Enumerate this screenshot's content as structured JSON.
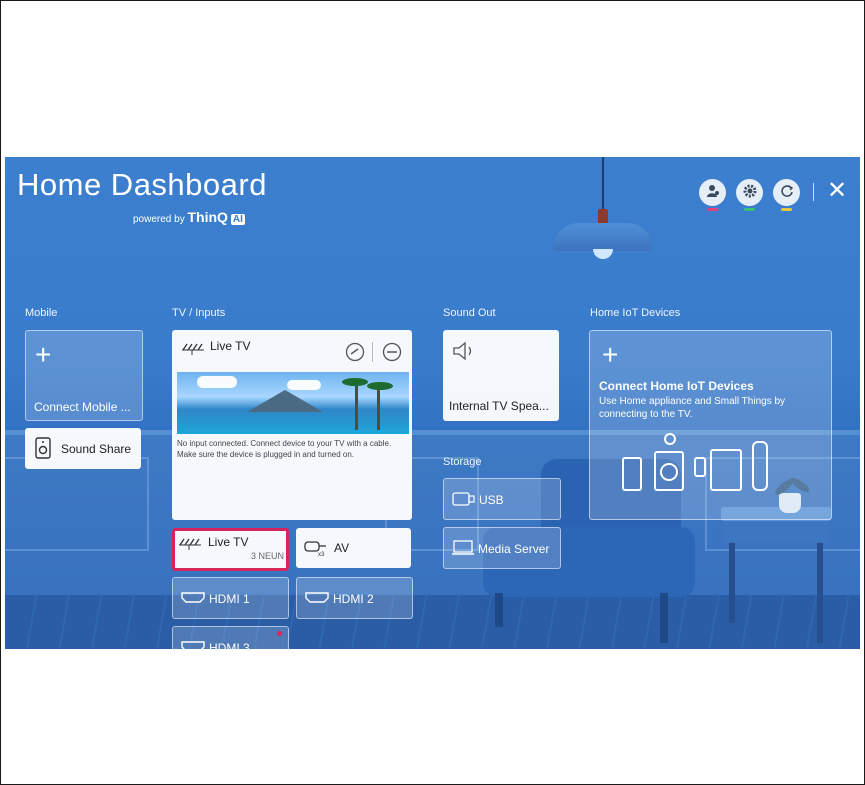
{
  "header": {
    "title": "Home Dashboard",
    "powered_by": "powered by",
    "brand": "ThinQ",
    "ai_badge": "AI",
    "buttons": [
      {
        "name": "account",
        "icon": "user-star-icon",
        "accent": "#e0447a"
      },
      {
        "name": "settings",
        "icon": "gear-icon",
        "accent": "#39c07a"
      },
      {
        "name": "refresh",
        "icon": "refresh-icon",
        "accent": "#e8c83a"
      }
    ],
    "close_icon": "close-icon"
  },
  "mobile": {
    "section_label": "Mobile",
    "connect_label": "Connect Mobile ...",
    "sound_share_label": "Sound Share"
  },
  "tv_inputs": {
    "section_label": "TV / Inputs",
    "live_tv_label": "Live TV",
    "preview_message": "No input connected. Connect device to your TV with a cable. Make sure the device is plugged in and turned on.",
    "inputs": [
      {
        "label": "Live TV",
        "sub": "3 NEUN",
        "selected": true
      },
      {
        "label": "AV"
      },
      {
        "label": "HDMI 1"
      },
      {
        "label": "HDMI 2"
      },
      {
        "label": "HDMI 3"
      }
    ]
  },
  "sound_out": {
    "section_label": "Sound Out",
    "device_label": "Internal TV Spea..."
  },
  "storage": {
    "section_label": "Storage",
    "items": [
      {
        "label": "USB"
      },
      {
        "label": "Media Server"
      }
    ]
  },
  "iot": {
    "section_label": "Home IoT Devices",
    "title": "Connect Home IoT Devices",
    "description": "Use Home appliance and Small Things by connecting to the TV."
  },
  "colors": {
    "background": "#3a7ccc",
    "selected_border": "#d8245d"
  }
}
